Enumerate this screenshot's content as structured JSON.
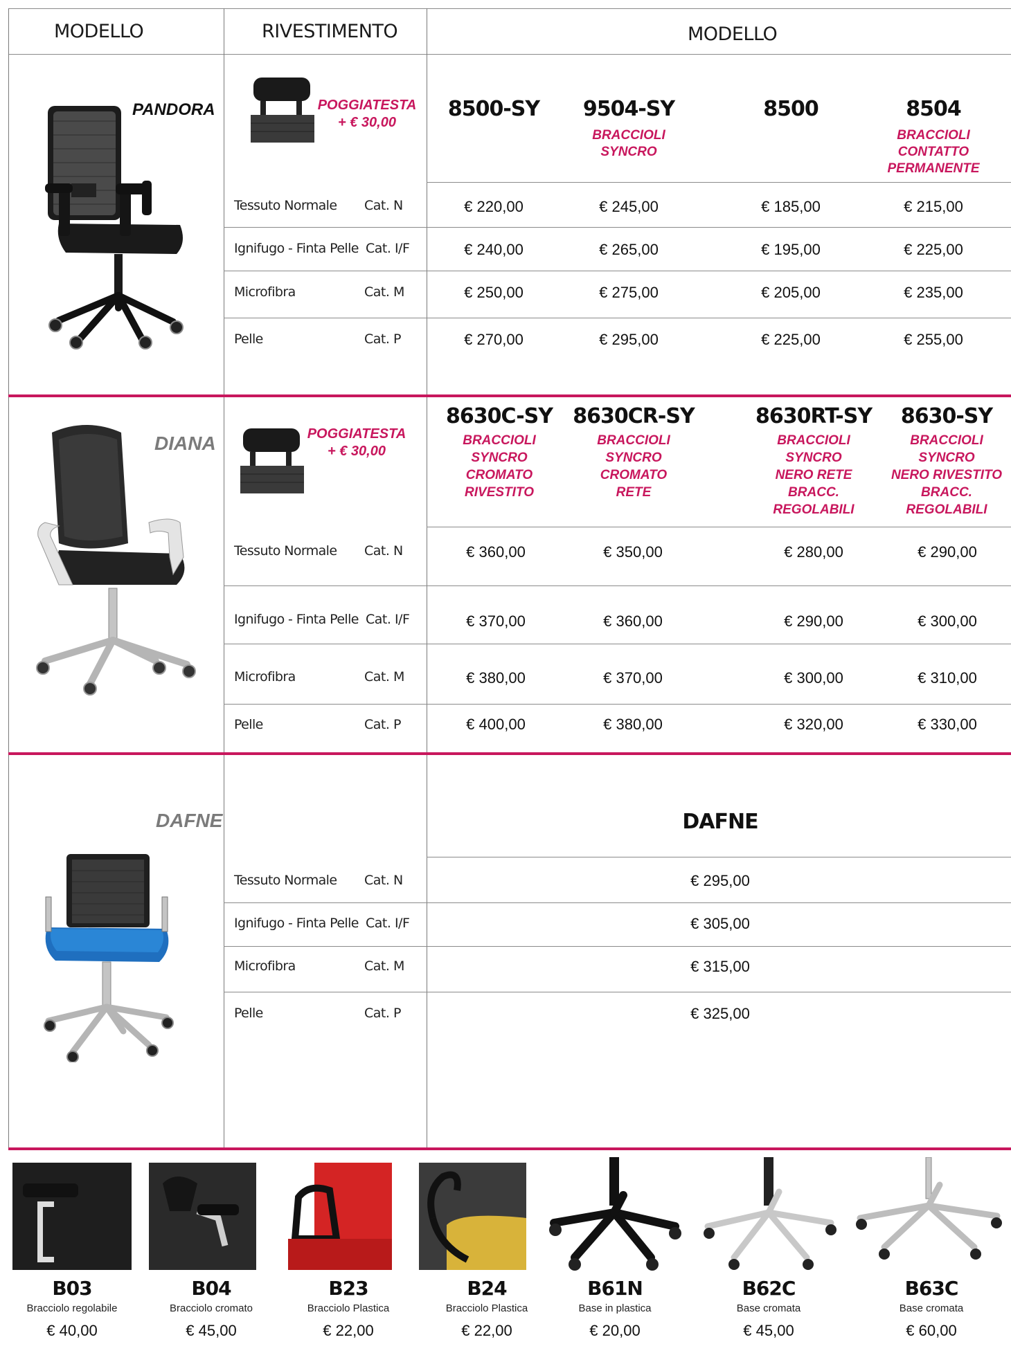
{
  "header": {
    "col1": "MODELLO",
    "col2": "RIVESTIMENTO",
    "col3": "MODELLO"
  },
  "coverings": [
    {
      "name": "Tessuto Normale",
      "cat": "Cat. N"
    },
    {
      "name": "Ignifugo - Finta Pelle",
      "cat": "Cat. I/F"
    },
    {
      "name": "Microfibra",
      "cat": "Cat. M"
    },
    {
      "name": "Pelle",
      "cat": "Cat. P"
    }
  ],
  "pandora": {
    "name": "PANDORA",
    "headrest": [
      "POGGIATESTA",
      "+ € 30,00"
    ],
    "models": [
      {
        "code": "8500-SY",
        "sub": []
      },
      {
        "code": "9504-SY",
        "sub": [
          "BRACCIOLI",
          "SYNCRO"
        ]
      },
      {
        "code": "8500",
        "sub": []
      },
      {
        "code": "8504",
        "sub": [
          "BRACCIOLI",
          "CONTATTO",
          "PERMANENTE"
        ]
      }
    ],
    "prices": [
      [
        "€ 220,00",
        "€ 245,00",
        "€ 185,00",
        "€ 215,00"
      ],
      [
        "€ 240,00",
        "€ 265,00",
        "€ 195,00",
        "€ 225,00"
      ],
      [
        "€ 250,00",
        "€ 275,00",
        "€ 205,00",
        "€ 235,00"
      ],
      [
        "€ 270,00",
        "€ 295,00",
        "€ 225,00",
        "€ 255,00"
      ]
    ]
  },
  "diana": {
    "name": "DIANA",
    "headrest": [
      "POGGIATESTA",
      "+ € 30,00"
    ],
    "models": [
      {
        "code": "8630C-SY",
        "sub": [
          "BRACCIOLI",
          "SYNCRO",
          "CROMATO",
          "RIVESTITO"
        ]
      },
      {
        "code": "8630CR-SY",
        "sub": [
          "BRACCIOLI",
          "SYNCRO",
          "CROMATO",
          "RETE"
        ]
      },
      {
        "code": "8630RT-SY",
        "sub": [
          "BRACCIOLI",
          "SYNCRO",
          "NERO RETE",
          "BRACC.",
          "REGOLABILI"
        ]
      },
      {
        "code": "8630-SY",
        "sub": [
          "BRACCIOLI",
          "SYNCRO",
          "NERO RIVESTITO",
          "BRACC.",
          "REGOLABILI"
        ]
      }
    ],
    "prices": [
      [
        "€ 360,00",
        "€ 350,00",
        "€ 280,00",
        "€ 290,00"
      ],
      [
        "€ 370,00",
        "€ 360,00",
        "€ 290,00",
        "€ 300,00"
      ],
      [
        "€ 380,00",
        "€ 370,00",
        "€ 300,00",
        "€ 310,00"
      ],
      [
        "€ 400,00",
        "€ 380,00",
        "€ 320,00",
        "€ 330,00"
      ]
    ]
  },
  "dafne": {
    "name": "DAFNE",
    "model": "DAFNE",
    "prices": [
      "€ 295,00",
      "€ 305,00",
      "€ 315,00",
      "€ 325,00"
    ]
  },
  "accessories": [
    {
      "code": "B03",
      "desc": "Bracciolo regolabile",
      "price": "€ 40,00"
    },
    {
      "code": "B04",
      "desc": "Bracciolo cromato",
      "price": "€ 45,00"
    },
    {
      "code": "B23",
      "desc": "Bracciolo Plastica",
      "price": "€ 22,00"
    },
    {
      "code": "B24",
      "desc": "Bracciolo Plastica",
      "price": "€ 22,00"
    },
    {
      "code": "B61N",
      "desc": "Base in plastica",
      "price": "€ 20,00"
    },
    {
      "code": "B62C",
      "desc": "Base cromata",
      "price": "€ 45,00"
    },
    {
      "code": "B63C",
      "desc": "Base cromata",
      "price": "€ 60,00"
    }
  ]
}
